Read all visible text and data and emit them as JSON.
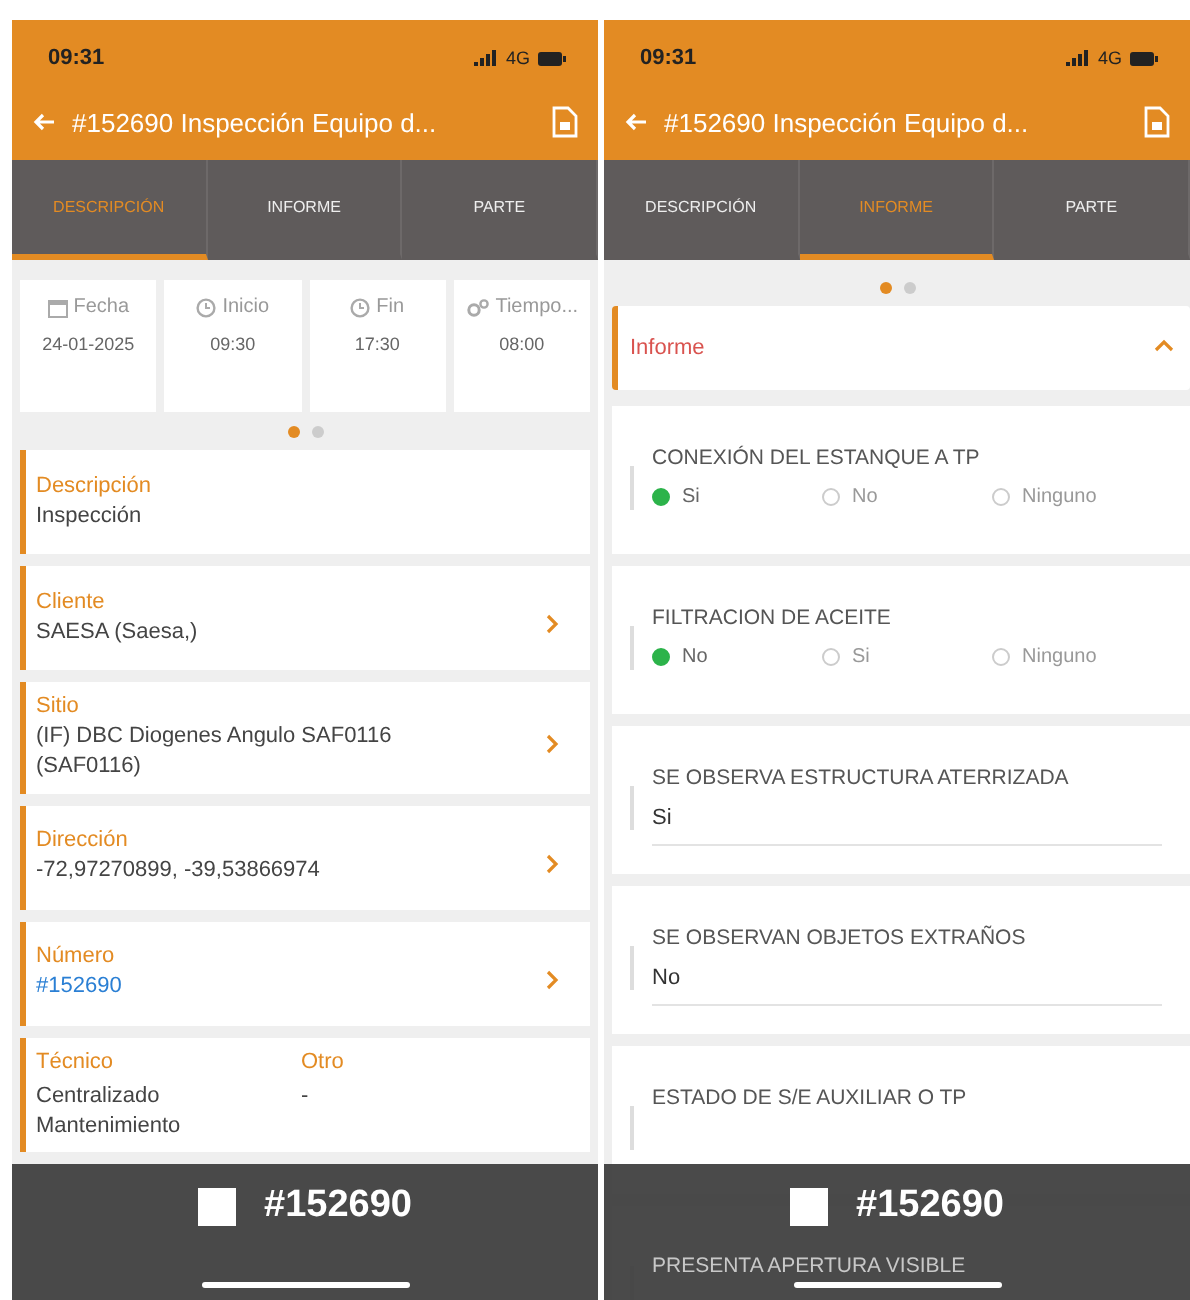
{
  "screens": [
    {
      "kind": "descripcion",
      "status_time": "09:31",
      "network": "4G",
      "title": "#152690 Inspección Equipo d...",
      "tabs": [
        {
          "label": "DESCRIPCIÓN",
          "selected": true
        },
        {
          "label": "INFORME",
          "selected": false
        },
        {
          "label": "PARTE",
          "selected": false
        }
      ],
      "tiles": [
        {
          "kind": "calendar",
          "label": "Fecha",
          "value": "24-01-2025"
        },
        {
          "kind": "clock",
          "label": "Inicio",
          "value": "09:30"
        },
        {
          "kind": "clock",
          "label": "Fin",
          "value": "17:30"
        },
        {
          "kind": "gears",
          "label": "Tiempo...",
          "value": "08:00"
        }
      ],
      "pager": [
        {
          "selected": true
        },
        {
          "selected": false
        }
      ],
      "fields": [
        {
          "label": "Descripción",
          "value": "Inspección",
          "chevron": false,
          "link": false
        },
        {
          "label": "Cliente",
          "value": "SAESA (Saesa,)",
          "chevron": true,
          "link": false
        },
        {
          "label": "Sitio",
          "value": "(IF) DBC  Diogenes Angulo SAF0116 (SAF0116)",
          "chevron": true,
          "link": false
        },
        {
          "label": "Dirección",
          "value": "-72,97270899, -39,53866974",
          "chevron": true,
          "link": false
        },
        {
          "label": "Número",
          "value": "#152690",
          "chevron": true,
          "link": true
        }
      ],
      "pair": [
        {
          "label": "Técnico",
          "value": "Centralizado Mantenimiento"
        },
        {
          "label": "Otro",
          "value": "-"
        }
      ],
      "footer": {
        "text": "#152690"
      }
    },
    {
      "kind": "informe",
      "status_time": "09:31",
      "network": "4G",
      "title": "#152690 Inspección Equipo d...",
      "tabs": [
        {
          "label": "DESCRIPCIÓN",
          "selected": false
        },
        {
          "label": "INFORME",
          "selected": true
        },
        {
          "label": "PARTE",
          "selected": false
        }
      ],
      "pager": [
        {
          "selected": true
        },
        {
          "selected": false
        }
      ],
      "section": {
        "title": "Informe",
        "expanded": true
      },
      "questions": [
        {
          "kind": "radio",
          "label": "CONEXIÓN DEL ESTANQUE A TP",
          "options": [
            {
              "label": "Si",
              "selected": true
            },
            {
              "label": "No",
              "selected": false
            },
            {
              "label": "Ninguno",
              "selected": false
            }
          ]
        },
        {
          "kind": "radio",
          "label": "FILTRACION DE ACEITE",
          "options": [
            {
              "label": "No",
              "selected": true
            },
            {
              "label": "Si",
              "selected": false
            },
            {
              "label": "Ninguno",
              "selected": false
            }
          ]
        },
        {
          "kind": "text",
          "label": "SE OBSERVA ESTRUCTURA ATERRIZADA",
          "value": "Si"
        },
        {
          "kind": "text",
          "label": "SE OBSERVAN OBJETOS EXTRAÑOS",
          "value": "No"
        },
        {
          "kind": "text",
          "label": "ESTADO DE S/E AUXILIAR O TP"
        },
        {
          "kind": "text",
          "label": "PRESENTA APERTURA VISIBLE"
        }
      ],
      "footer": {
        "text": "#152690"
      }
    }
  ]
}
